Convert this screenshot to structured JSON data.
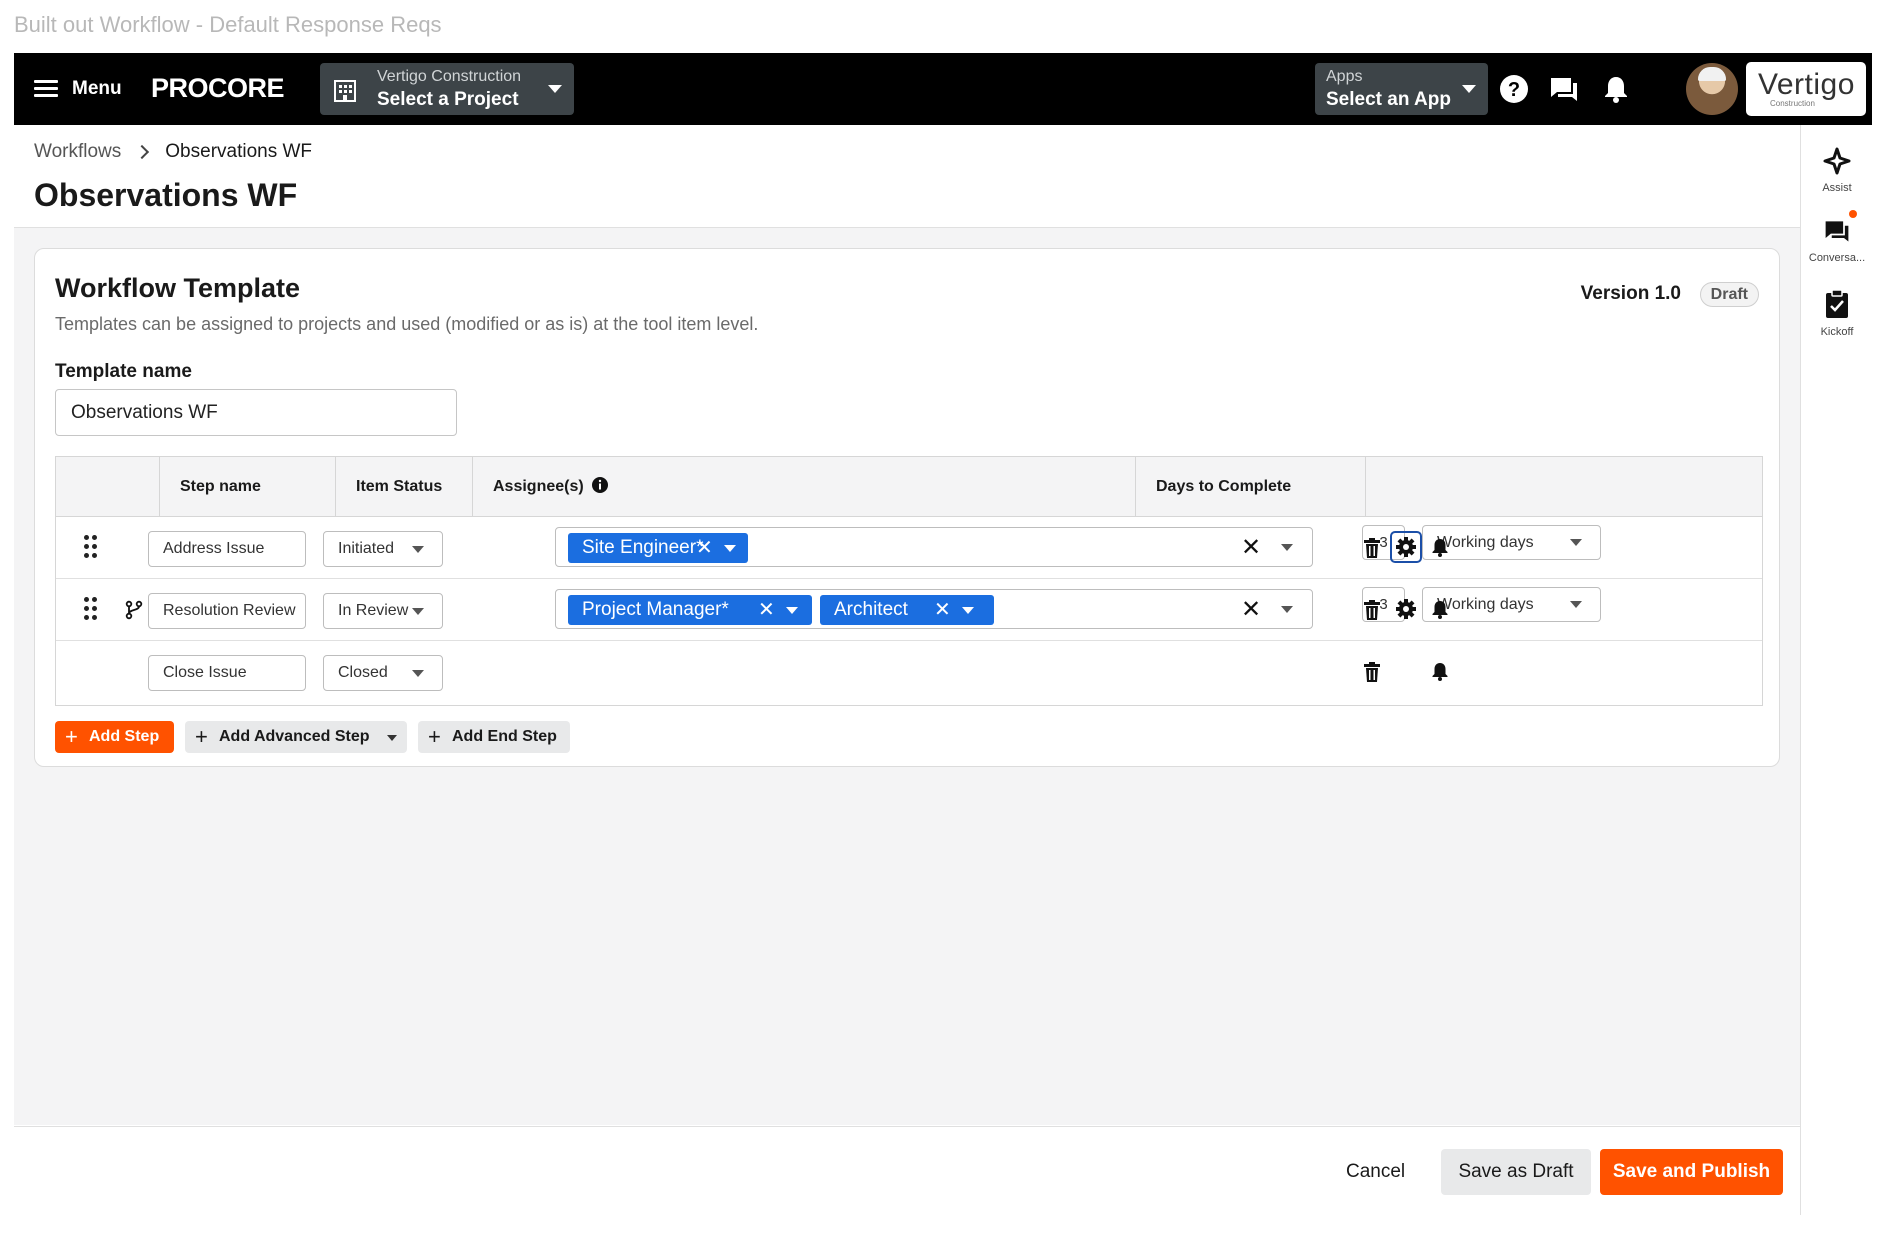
{
  "page_caption": "Built out Workflow - Default Response Reqs",
  "navbar": {
    "menu_label": "Menu",
    "logo": "PROCORE",
    "project_company": "Vertigo Construction",
    "project_label": "Select a Project",
    "apps_small": "Apps",
    "apps_label": "Select an App",
    "company_logo": "Vertigo",
    "company_logo_sub": "Construction"
  },
  "breadcrumb": {
    "parent": "Workflows",
    "current": "Observations WF"
  },
  "page_title": "Observations WF",
  "right_rail": [
    {
      "label": "Assist",
      "icon": "assist-icon"
    },
    {
      "label": "Conversa...",
      "icon": "conversations-icon"
    },
    {
      "label": "Kickoff",
      "icon": "kickoff-icon"
    }
  ],
  "card": {
    "title": "Workflow Template",
    "subtitle": "Templates can be assigned to projects and used (modified or as is) at the tool item level.",
    "version": "Version 1.0",
    "status": "Draft",
    "template_name_label": "Template name",
    "template_name_value": "Observations WF"
  },
  "table": {
    "headers": [
      "Step name",
      "Item Status",
      "Assignee(s)",
      "Days to Complete"
    ],
    "rows": [
      {
        "step": "Address Issue",
        "status": "Initiated",
        "assignees": [
          "Site Engineer*"
        ],
        "days": "3",
        "day_type": "Working days"
      },
      {
        "step": "Resolution Review",
        "status": "In Review",
        "assignees": [
          "Project Manager*",
          "Architect"
        ],
        "days": "3",
        "day_type": "Working days"
      },
      {
        "step": "Close Issue",
        "status": "Closed"
      }
    ]
  },
  "actions": {
    "add_step": "Add Step",
    "add_advanced_step": "Add Advanced Step",
    "add_end_step": "Add End Step"
  },
  "footer": {
    "cancel": "Cancel",
    "save_draft": "Save as Draft",
    "save_publish": "Save and Publish"
  },
  "colors": {
    "brand_orange": "#ff5200",
    "chip_blue": "#1b6ee0",
    "nav_black": "#000000"
  }
}
